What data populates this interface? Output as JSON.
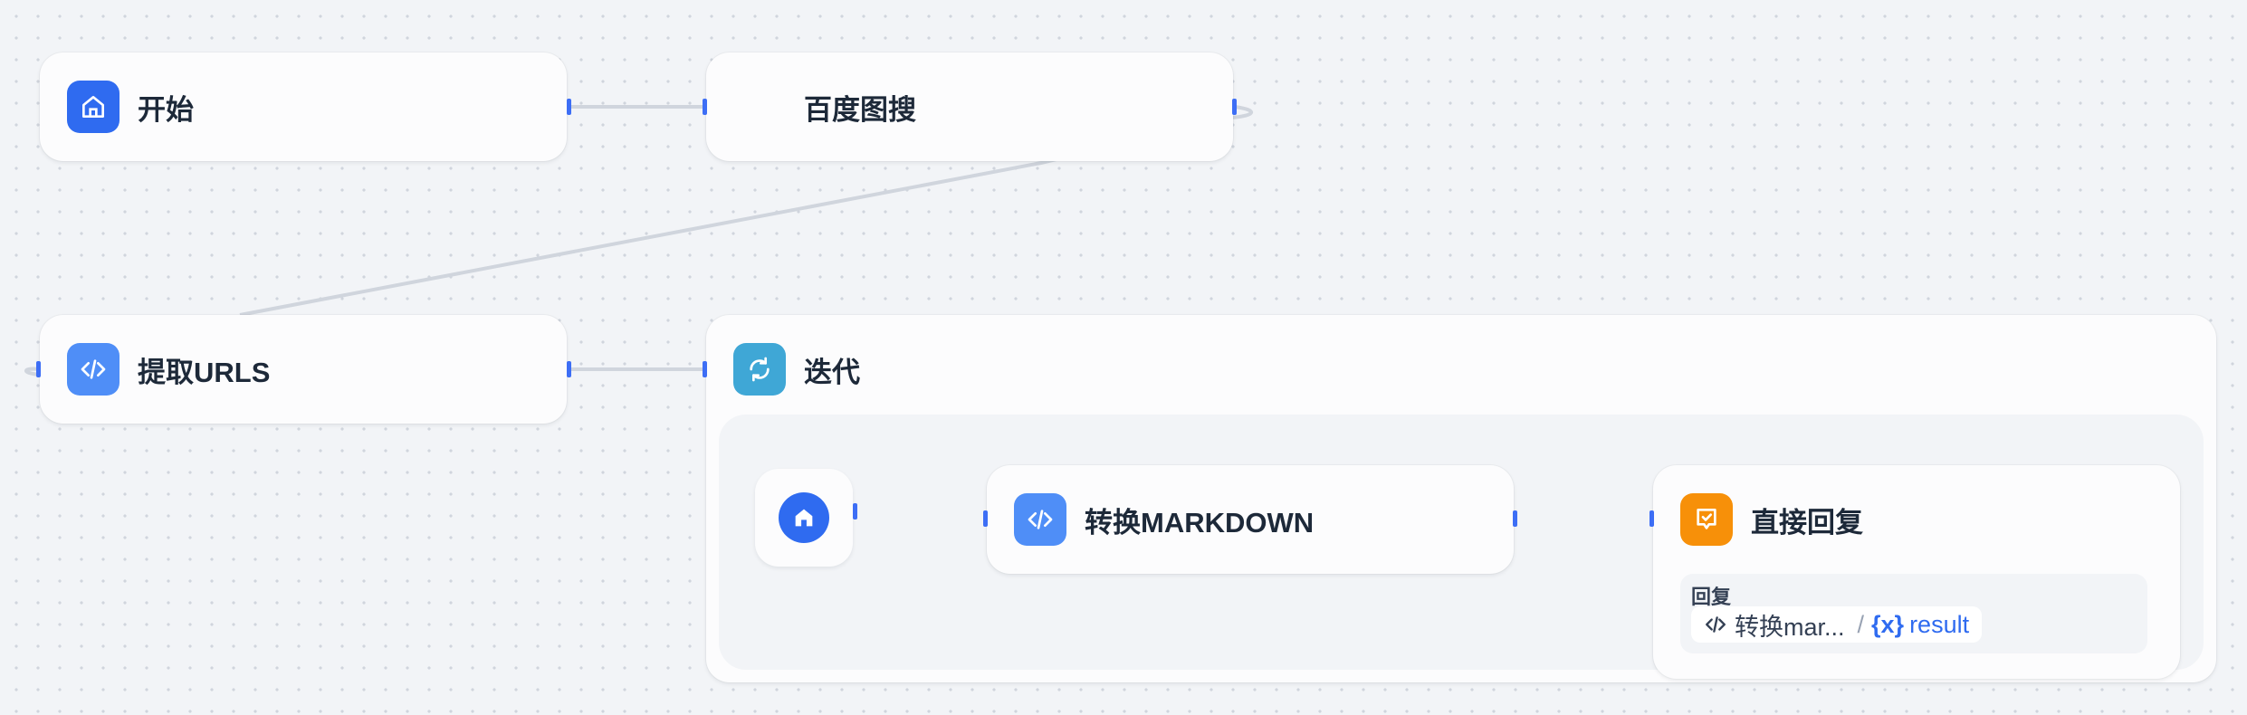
{
  "colors": {
    "canvas_bg": "#f2f4f7",
    "node_bg": "#fcfcfd",
    "handle": "#3d6ef5",
    "edge": "#d0d5dd",
    "start_icon": "#2f6bf0",
    "code_icon": "#4f8ef7",
    "iteration_icon": "#3fa7d6",
    "answer_icon": "#f79009",
    "variable": "#2f6bf0"
  },
  "nodes": {
    "start": {
      "title": "开始",
      "icon": "home-icon"
    },
    "baidu_image_search": {
      "title": "百度图搜",
      "icon": ""
    },
    "extract_urls": {
      "title": "提取URLS",
      "icon": "code-icon"
    },
    "iteration": {
      "title": "迭代",
      "icon": "refresh-icon"
    },
    "iteration_start": {
      "icon": "home-icon"
    },
    "convert_markdown": {
      "title": "转换MARKDOWN",
      "icon": "code-icon"
    },
    "direct_reply": {
      "title": "直接回复",
      "icon": "reply-check-icon",
      "reply_label": "回复",
      "variable": {
        "source_node": "转换mar...",
        "separator": "/",
        "var_icon": "{x}",
        "var_name": "result"
      }
    }
  }
}
